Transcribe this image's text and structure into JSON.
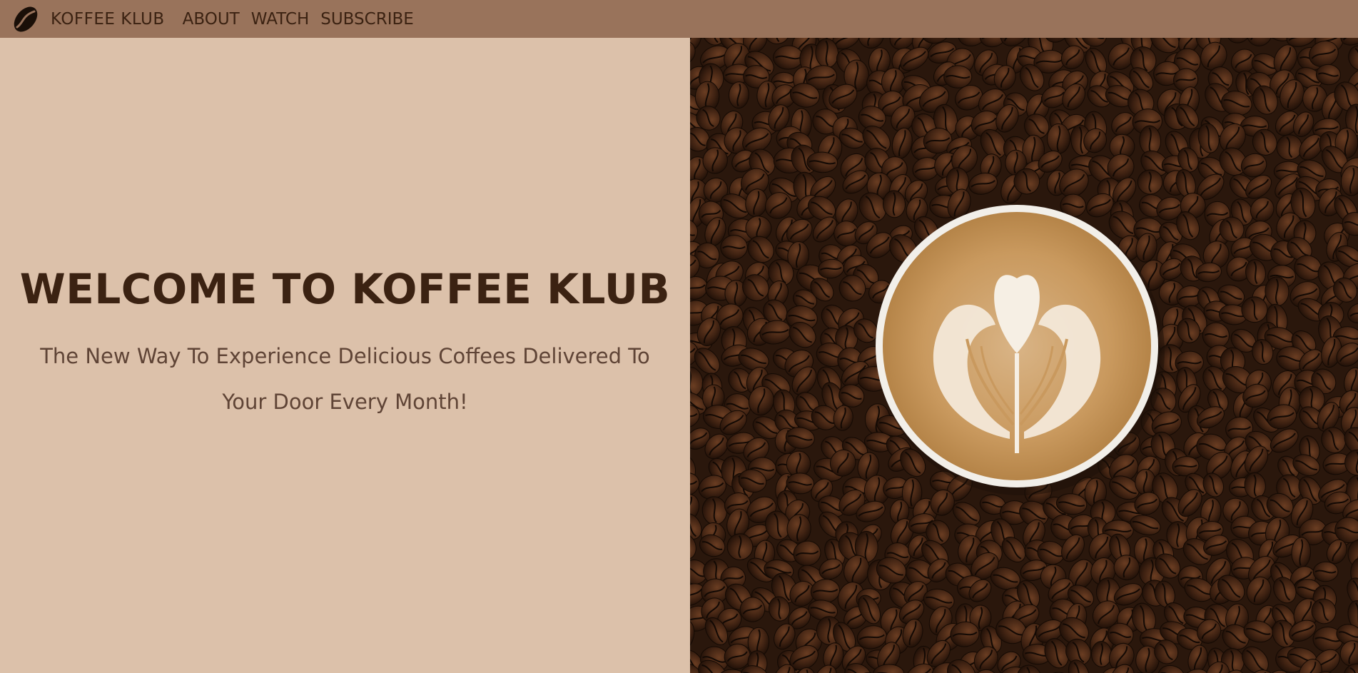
{
  "nav": {
    "logo_icon": "coffee-bean-icon",
    "brand": "KOFFEE KLUB",
    "links": [
      "ABOUT",
      "WATCH",
      "SUBSCRIBE"
    ]
  },
  "hero": {
    "title": "WELCOME TO KOFFEE KLUB",
    "subtitle": "The New Way To Experience Delicious Coffees Delivered To Your Door Every Month!"
  },
  "image": {
    "subject": "latte-art-cup-on-coffee-beans"
  },
  "colors": {
    "nav_bg": "#99735b",
    "page_bg": "#dcc1aa",
    "text_dark": "#3b2212",
    "text_muted": "#5f4436"
  }
}
